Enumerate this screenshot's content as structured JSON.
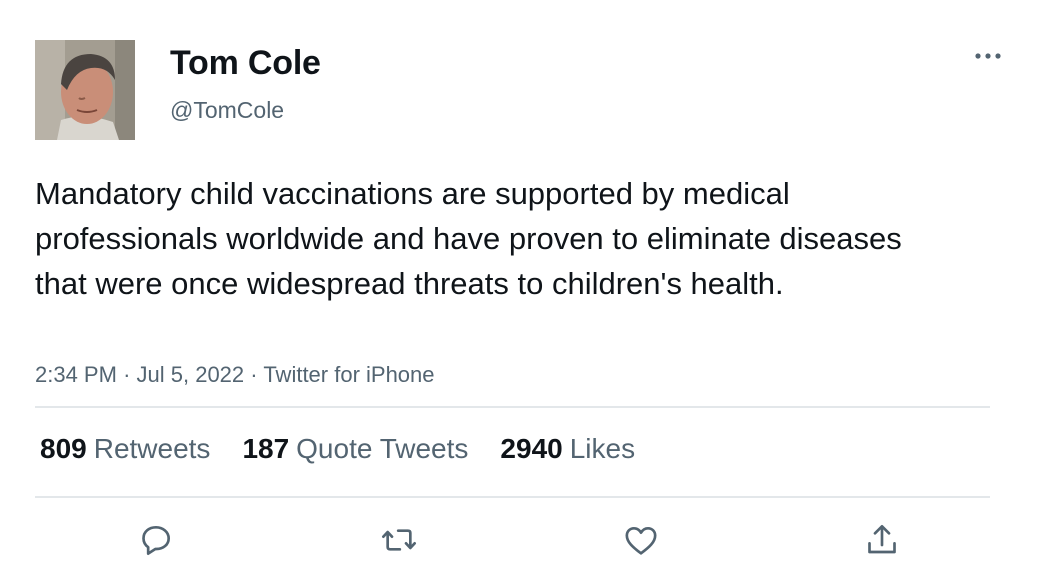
{
  "tweet": {
    "author": {
      "display_name": "Tom Cole",
      "handle": "@TomCole"
    },
    "text": "Mandatory child vaccinations are supported by medical professionals worldwide and have proven to eliminate diseases that were once widespread threats to children's health.",
    "time": "2:34 PM",
    "date": "Jul 5, 2022",
    "source": "Twitter for iPhone",
    "separator": "·",
    "stats": {
      "retweets": {
        "count": "809",
        "label": "Retweets"
      },
      "quote_tweets": {
        "count": "187",
        "label": "Quote Tweets"
      },
      "likes": {
        "count": "2940",
        "label": "Likes"
      }
    }
  },
  "icons": {
    "more": "more-horizontal-icon",
    "reply": "reply-icon",
    "retweet": "retweet-icon",
    "like": "heart-icon",
    "share": "share-icon"
  },
  "colors": {
    "text_primary": "#0f1419",
    "text_secondary": "#536471",
    "divider": "#e3e7ea"
  }
}
